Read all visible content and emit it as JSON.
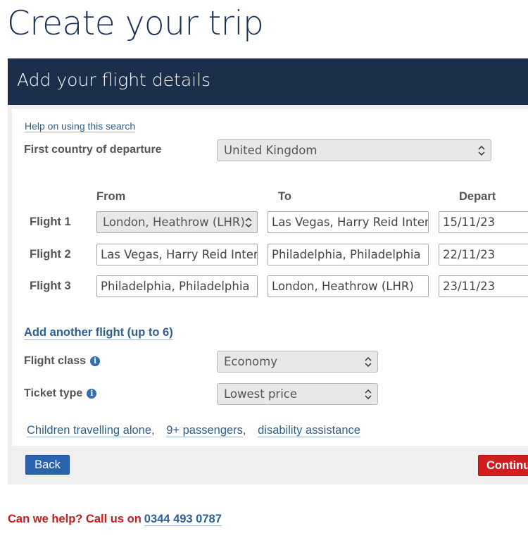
{
  "page": {
    "title": "Create your trip"
  },
  "panel": {
    "title": "Add your flight details"
  },
  "help_link": "Help on using this search",
  "departure_country": {
    "label": "First country of departure",
    "value": "United Kingdom"
  },
  "columns": {
    "from": "From",
    "to": "To",
    "depart": "Depart"
  },
  "flights": [
    {
      "label": "Flight 1",
      "from": "London, Heathrow (LHR)",
      "to": "Las Vegas, Harry Reid International",
      "depart": "15/11/23"
    },
    {
      "label": "Flight 2",
      "from": "Las Vegas, Harry Reid International",
      "to": "Philadelphia, Philadelphia",
      "depart": "22/11/23"
    },
    {
      "label": "Flight 3",
      "from": "Philadelphia, Philadelphia",
      "to": "London, Heathrow (LHR)",
      "depart": "23/11/23"
    }
  ],
  "add_flight": "Add another flight (up to 6)",
  "flight_class": {
    "label": "Flight class",
    "value": "Economy"
  },
  "ticket_type": {
    "label": "Ticket type",
    "value": "Lowest price"
  },
  "bottom_links": [
    {
      "text": "Children travelling alone",
      "sep": ","
    },
    {
      "text": "9+ passengers",
      "sep": ","
    },
    {
      "text": "disability assistance",
      "sep": ""
    }
  ],
  "buttons": {
    "back": "Back",
    "continue": "Continue"
  },
  "footer": {
    "help_text": "Can we help? Call us on",
    "phone": "0344 493 0787"
  },
  "icons": {
    "info": "i"
  },
  "colors": {
    "navy": "#1b2f4d",
    "link": "#2e5f8f",
    "red": "#d01e1e",
    "back_blue": "#2a63ad"
  }
}
